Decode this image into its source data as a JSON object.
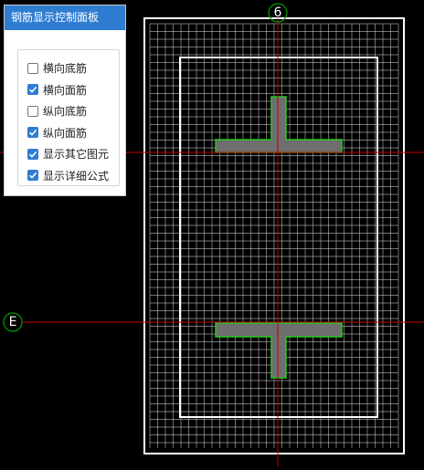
{
  "panel": {
    "title": "钢筋显示控制面板",
    "options": [
      {
        "label": "横向底筋",
        "checked": false
      },
      {
        "label": "横向面筋",
        "checked": true
      },
      {
        "label": "纵向底筋",
        "checked": false
      },
      {
        "label": "纵向面筋",
        "checked": true
      },
      {
        "label": "显示其它图元",
        "checked": true
      },
      {
        "label": "显示详细公式",
        "checked": true
      }
    ]
  },
  "axes": {
    "vertical_label": "6",
    "horizontal_label": "E"
  },
  "colors": {
    "panel_header": "#2f7cd1",
    "axis_line": "#c00000",
    "axis_circle": "#00a000",
    "slab_border": "#ffffff",
    "rebar_grid": "#cfcfcf",
    "member_fill": "#6e6e6e",
    "member_outline": "#22cc22"
  }
}
